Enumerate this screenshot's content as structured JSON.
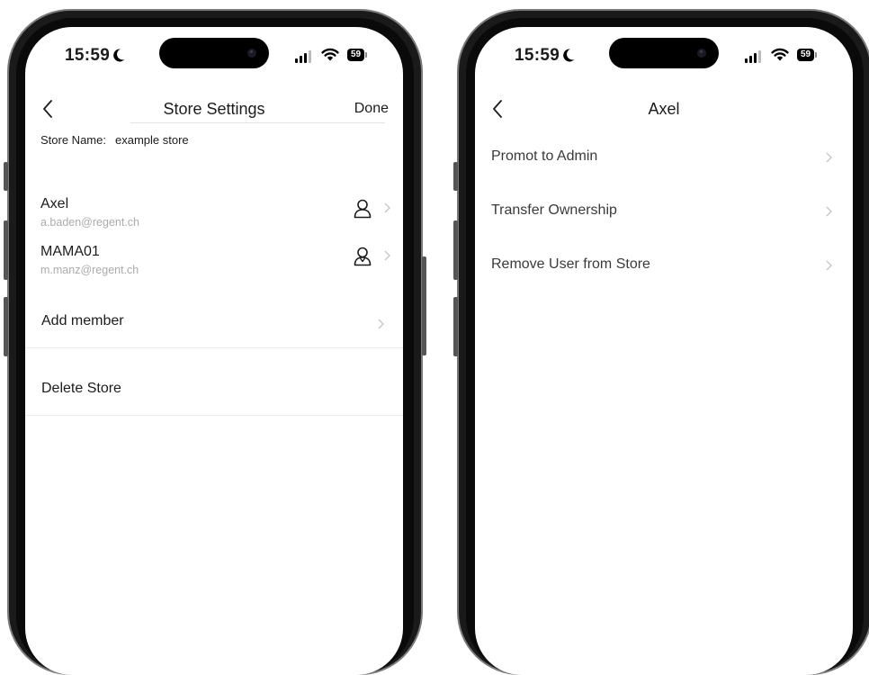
{
  "left_phone": {
    "status": {
      "time": "15:59",
      "battery": "59"
    },
    "nav": {
      "title": "Store Settings",
      "done_label": "Done"
    },
    "store": {
      "label": "Store Name:",
      "value": "example store"
    },
    "members": [
      {
        "name": "Axel",
        "email": "a.baden@regent.ch",
        "role_icon": "person-icon"
      },
      {
        "name": "MAMA01",
        "email": "m.manz@regent.ch",
        "role_icon": "person-admin-icon"
      }
    ],
    "add_member_label": "Add member",
    "delete_store_label": "Delete Store"
  },
  "right_phone": {
    "status": {
      "time": "15:59",
      "battery": "59"
    },
    "nav": {
      "title": "Axel"
    },
    "options": [
      {
        "label": "Promot to Admin"
      },
      {
        "label": "Transfer Ownership"
      },
      {
        "label": "Remove User from Store"
      }
    ]
  },
  "colors": {
    "text": "#1c1c1e",
    "secondary_text": "#ababab",
    "chevron": "#c4c4c4",
    "divider": "#ebebeb",
    "frame": "#1a1a1a"
  }
}
